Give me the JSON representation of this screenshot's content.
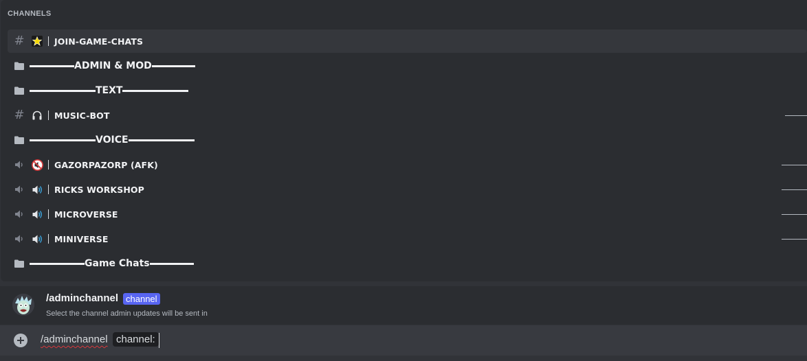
{
  "section_header": "CHANNELS",
  "channels": [
    {
      "kind": "text",
      "emoji": "star-emoji",
      "label": "JOIN-GAME-CHATS",
      "selected": true
    },
    {
      "kind": "category",
      "label": "ADMIN & MOD"
    },
    {
      "kind": "category",
      "label": "TEXT"
    },
    {
      "kind": "text",
      "emoji": "headphones-emoji",
      "label": "MUSIC-BOT"
    },
    {
      "kind": "category",
      "label": "VOICE"
    },
    {
      "kind": "voice",
      "emoji": "muted-speaker-emoji",
      "label": "GAZORPAZORP (AFK)"
    },
    {
      "kind": "voice",
      "emoji": "speaker-emoji",
      "label": "RICKS WORKSHOP"
    },
    {
      "kind": "voice",
      "emoji": "speaker-emoji",
      "label": "MICROVERSE"
    },
    {
      "kind": "voice",
      "emoji": "speaker-emoji",
      "label": "MINIVERSE"
    },
    {
      "kind": "category",
      "label": "Game Chats"
    }
  ],
  "command": {
    "name": "/adminchannel",
    "option_badge": "channel",
    "description": "Select the channel admin updates will be sent in"
  },
  "input": {
    "command_text": "/adminchannel",
    "option_pill": "channel:"
  },
  "colors": {
    "background": "#313338",
    "popup": "#2b2d31",
    "accent": "#5865f2",
    "text": "#f2f3f5",
    "muted": "#b5bac1"
  }
}
